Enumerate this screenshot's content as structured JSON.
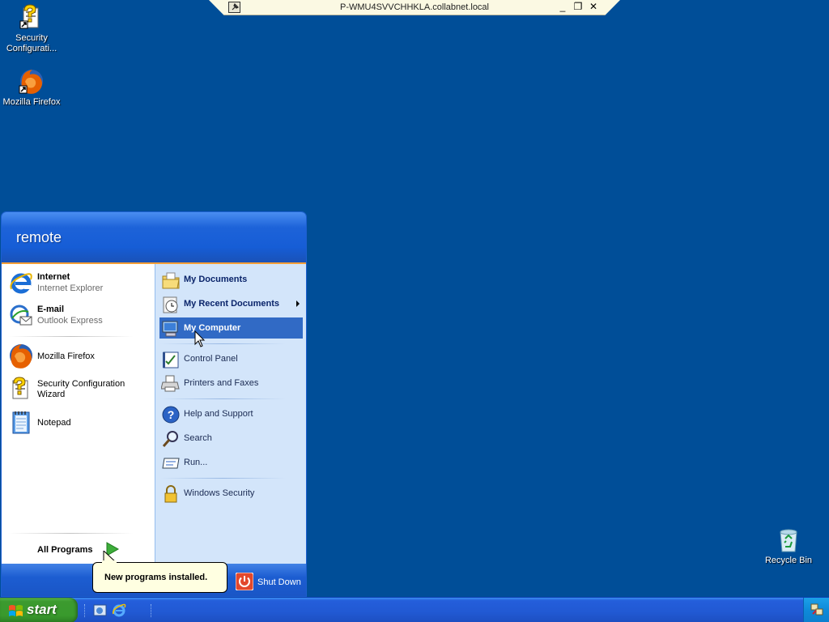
{
  "rdp_bar": {
    "title": "P-WMU4SVVCHHKLA.collabnet.local",
    "minimize": "_",
    "restore": "❐",
    "close": "✕"
  },
  "desktop_icons": [
    {
      "label": "Security\nConfigurati...",
      "icon": "security-config-icon"
    },
    {
      "label": "Mozilla Firefox",
      "icon": "firefox-icon"
    },
    {
      "label": "Recycle Bin",
      "icon": "recycle-bin-icon"
    }
  ],
  "start_menu": {
    "username": "remote",
    "pinned": [
      {
        "title": "Internet",
        "subtitle": "Internet Explorer",
        "icon": "internet-explorer-icon"
      },
      {
        "title": "E-mail",
        "subtitle": "Outlook Express",
        "icon": "outlook-express-icon"
      }
    ],
    "recent": [
      {
        "label": "Mozilla Firefox",
        "icon": "firefox-icon"
      },
      {
        "label": "Security Configuration",
        "label2": "Wizard",
        "icon": "security-config-icon"
      },
      {
        "label": "Notepad",
        "icon": "notepad-icon"
      }
    ],
    "all_programs": "All Programs",
    "places": [
      {
        "label": "My Documents",
        "icon": "my-documents-icon",
        "bold": true
      },
      {
        "label": "My Recent Documents",
        "icon": "recent-documents-icon",
        "bold": true,
        "submenu": true
      },
      {
        "label": "My Computer",
        "icon": "my-computer-icon",
        "bold": true,
        "selected": true
      },
      {
        "label": "Control Panel",
        "icon": "control-panel-icon"
      },
      {
        "label": "Printers and Faxes",
        "icon": "printer-icon"
      },
      {
        "label": "Help and Support",
        "icon": "help-icon"
      },
      {
        "label": "Search",
        "icon": "search-icon"
      },
      {
        "label": "Run...",
        "icon": "run-icon"
      },
      {
        "label": "Windows Security",
        "icon": "lock-icon"
      }
    ],
    "shutdown": "Shut Down"
  },
  "balloon": {
    "text": "New programs installed."
  },
  "taskbar": {
    "start_label": "start",
    "quick_launch": [
      "show-desktop-icon",
      "internet-explorer-icon"
    ],
    "tray": [
      "network-icon"
    ]
  },
  "colors": {
    "desktop": "#004e98",
    "selection": "#316ac5",
    "start_green": "#399a2d",
    "taskbar_blue": "#245edb"
  }
}
